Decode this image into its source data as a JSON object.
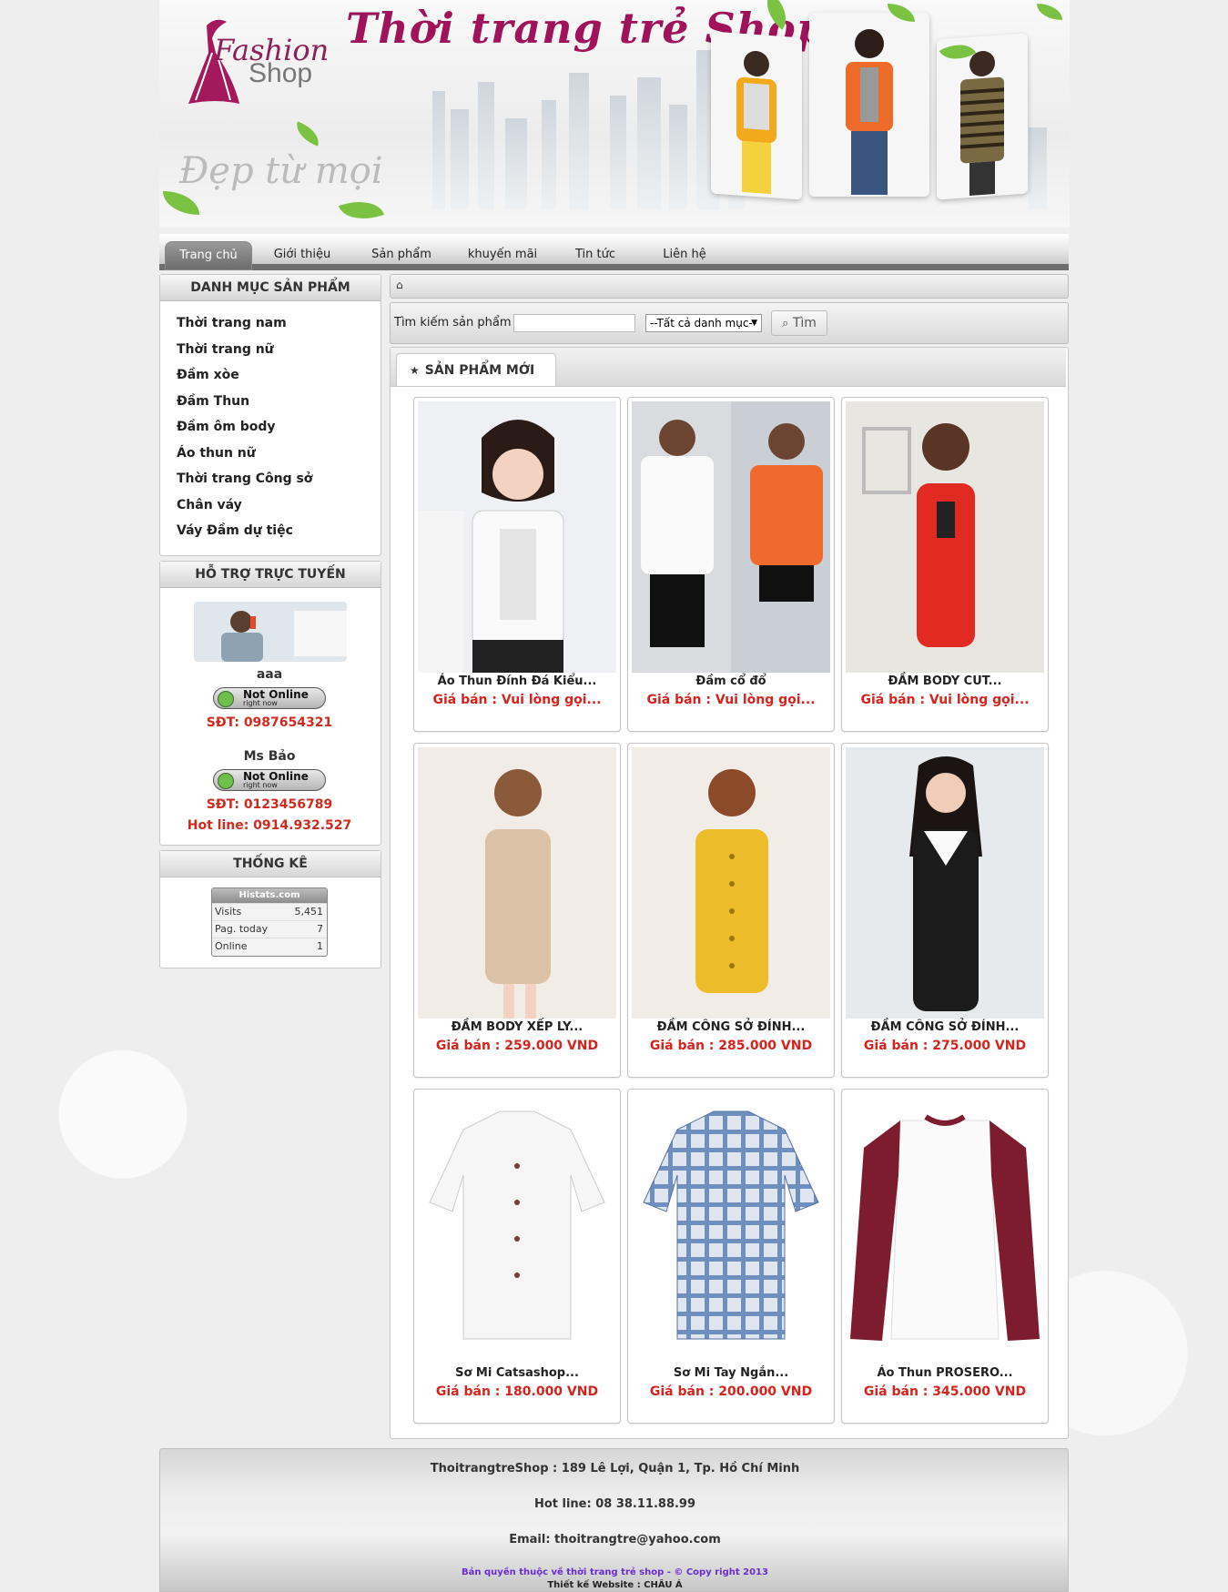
{
  "header": {
    "logo_line1": "Fashion",
    "logo_line2": "Shop",
    "site_title": "Thời trang trẻ Shop",
    "slogan": "Đẹp từ mọi"
  },
  "nav": {
    "items": [
      {
        "label": "Trang chủ",
        "active": true
      },
      {
        "label": "Giới thiệu"
      },
      {
        "label": "Sản phẩm"
      },
      {
        "label": "khuyến mãi"
      },
      {
        "label": "Tin tức"
      },
      {
        "label": "Liên hệ"
      }
    ]
  },
  "sidebar": {
    "categories_title": "DANH MỤC SẢN PHẨM",
    "categories": [
      "Thời trang nam",
      "Thời trang nữ",
      "Đầm xòe",
      "Đầm Thun",
      "Đầm ôm body",
      "Áo thun nữ",
      "Thời trang Công sở",
      "Chân váy",
      "Váy Đầm dự tiệc"
    ],
    "support_title": "HỖ TRỢ TRỰC TUYẾN",
    "support": [
      {
        "name": "aaa",
        "status_main": "Not Online",
        "status_sub": "right now",
        "phone": "SĐT: 0987654321"
      },
      {
        "name": "Ms Bảo",
        "status_main": "Not Online",
        "status_sub": "right now",
        "phone": "SĐT: 0123456789"
      }
    ],
    "hotline": "Hot line: 0914.932.527",
    "stats_title": "THỐNG KÊ",
    "stats": {
      "brand": "Histats.com",
      "rows": [
        {
          "label": "Visits",
          "value": "5,451"
        },
        {
          "label": "Pag. today",
          "value": "7"
        },
        {
          "label": "Online",
          "value": "1"
        }
      ]
    }
  },
  "search": {
    "label": "Tìm kiếm sản phẩm",
    "placeholder": "",
    "category_selected": "--Tất cả danh mục--",
    "button": "Tìm"
  },
  "products": {
    "tab_label": "SẢN PHẨM MỚI",
    "items": [
      {
        "name": "Áo Thun Đính Đá Kiểu...",
        "price": "Giá bán : Vui lòng gọi..."
      },
      {
        "name": "Đầm cổ đổ",
        "price": "Giá bán : Vui lòng gọi..."
      },
      {
        "name": "ĐẦM BODY CUT...",
        "price": "Giá bán : Vui lòng gọi..."
      },
      {
        "name": "ĐẦM BODY XẾP LY...",
        "price": "Giá bán : 259.000 VND"
      },
      {
        "name": "ĐẦM CÔNG SỞ ĐÍNH...",
        "price": "Giá bán : 285.000 VND"
      },
      {
        "name": "ĐẦM CÔNG SỞ ĐÍNH...",
        "price": "Giá bán : 275.000 VND"
      },
      {
        "name": "Sơ Mi Catsashop...",
        "price": "Giá bán : 180.000 VND"
      },
      {
        "name": "Sơ Mi Tay Ngắn...",
        "price": "Giá bán : 200.000 VND"
      },
      {
        "name": "Áo Thun PROSERO...",
        "price": "Giá bán : 345.000 VND"
      }
    ]
  },
  "footer": {
    "address": "ThoitrangtreShop : 189 Lê Lợi, Quận 1, Tp. Hồ Chí Minh",
    "hotline": "Hot line: 08 38.11.88.99",
    "email": "Email: thoitrangtre@yahoo.com",
    "copyright": "Bản quyền thuộc về thời trang trẻ shop - © Copy right 2013",
    "designer": "Thiết kế Website : CHÂU Á"
  },
  "colors": {
    "price_red": "#d6231c",
    "title_magenta": "#a0125a",
    "nav_dark": "#6e6e6e",
    "copyright_purple": "#6a2bd4"
  }
}
